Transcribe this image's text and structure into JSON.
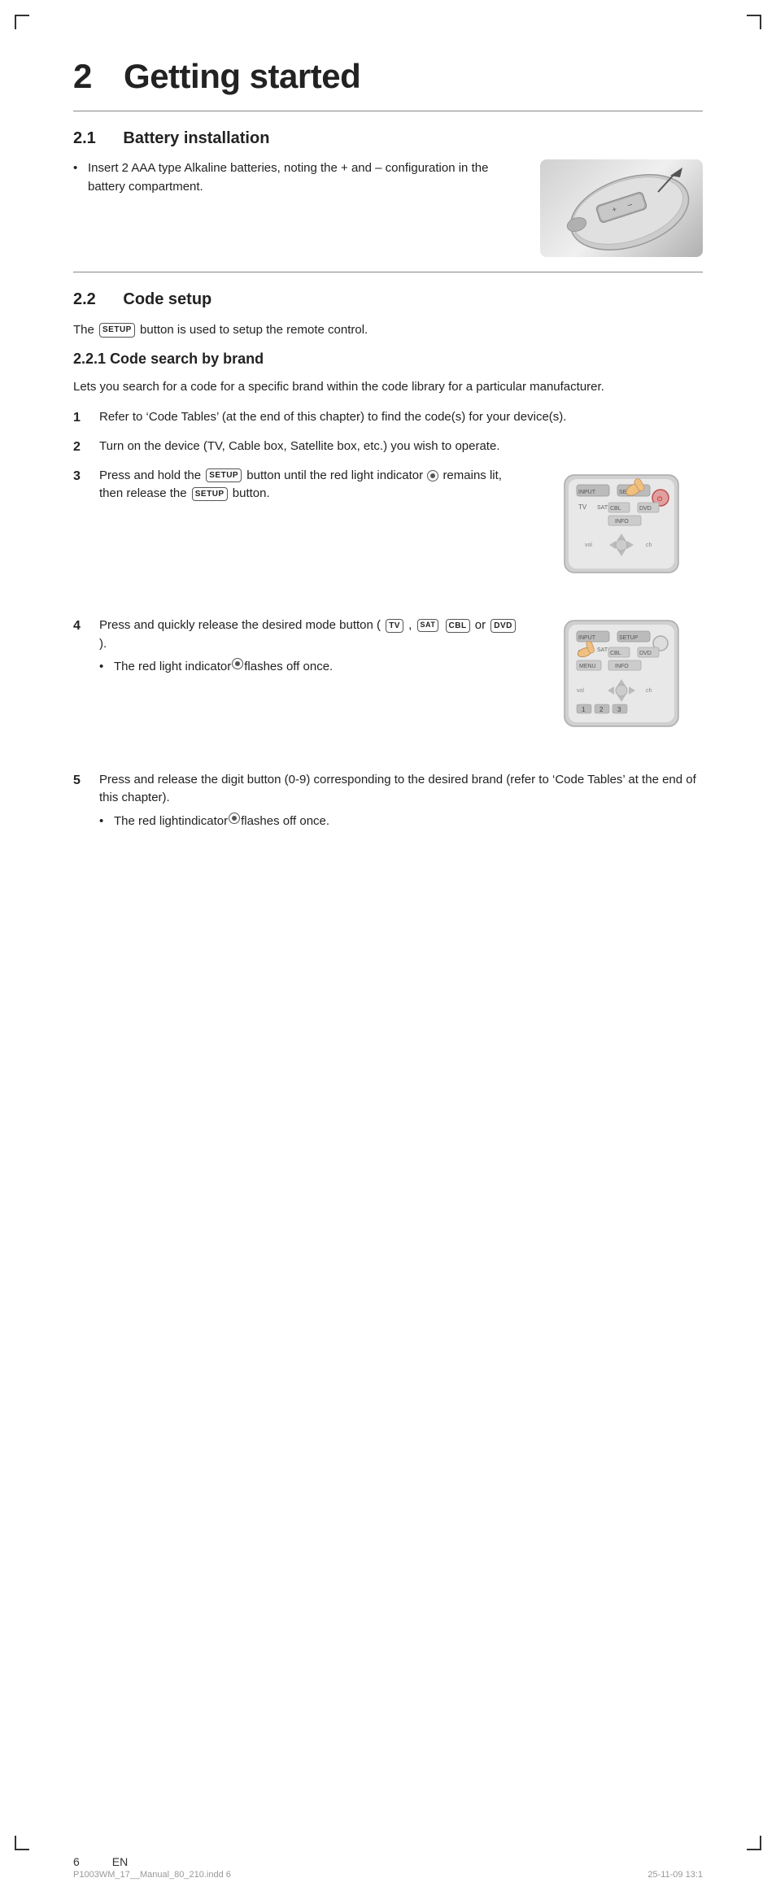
{
  "page": {
    "chapter_number": "2",
    "chapter_title": "Getting started",
    "section_21_number": "2.1",
    "section_21_title": "Battery installation",
    "section_22_number": "2.2",
    "section_22_title": "Code setup",
    "section_221_number": "2.2.1",
    "section_221_title": "Code search by brand",
    "battery_bullet": "Insert 2 AAA type Alkaline batteries, noting the + and – configuration in the battery compartment.",
    "code_setup_para": "button is used to setup the remote control.",
    "code_setup_badge": "SETUP",
    "code_search_intro": "Lets you search for a code for a specific brand within the code library for a particular manufacturer.",
    "steps": [
      {
        "num": "1",
        "text": "Refer to ‘Code Tables’ (at the end of this chapter) to find the code(s) for your device(s)."
      },
      {
        "num": "2",
        "text": "Turn on the device (TV, Cable box, Satellite box, etc.) you wish to operate."
      },
      {
        "num": "3",
        "text_parts": [
          "Press and hold the",
          " button until the red light indicator",
          " remains lit, then release the",
          " button."
        ],
        "badge1": "SETUP",
        "badge2": "SETUP",
        "has_image": true
      },
      {
        "num": "4",
        "text_parts": [
          "Press and quickly release the desired mode button (",
          "TV",
          ",",
          "CBL",
          " or",
          "DVD",
          ")."
        ],
        "sub_bullet": "The red light indicator flashes off once.",
        "badge_tv": "TV",
        "badge_sat": "SAT",
        "badge_cbl": "CBL",
        "badge_dvd": "DVD",
        "has_image": true
      },
      {
        "num": "5",
        "text": "Press and release the digit button (0-9) corresponding to the desired brand (refer to ‘Code Tables’ at the end of this chapter).",
        "sub_bullet": "The red light indicator flashes off once."
      }
    ],
    "footer": {
      "page_num": "6",
      "lang": "EN",
      "file": "P1003WM_17__Manual_80_210.indd   6",
      "date": "25-11-09   13:1"
    }
  }
}
